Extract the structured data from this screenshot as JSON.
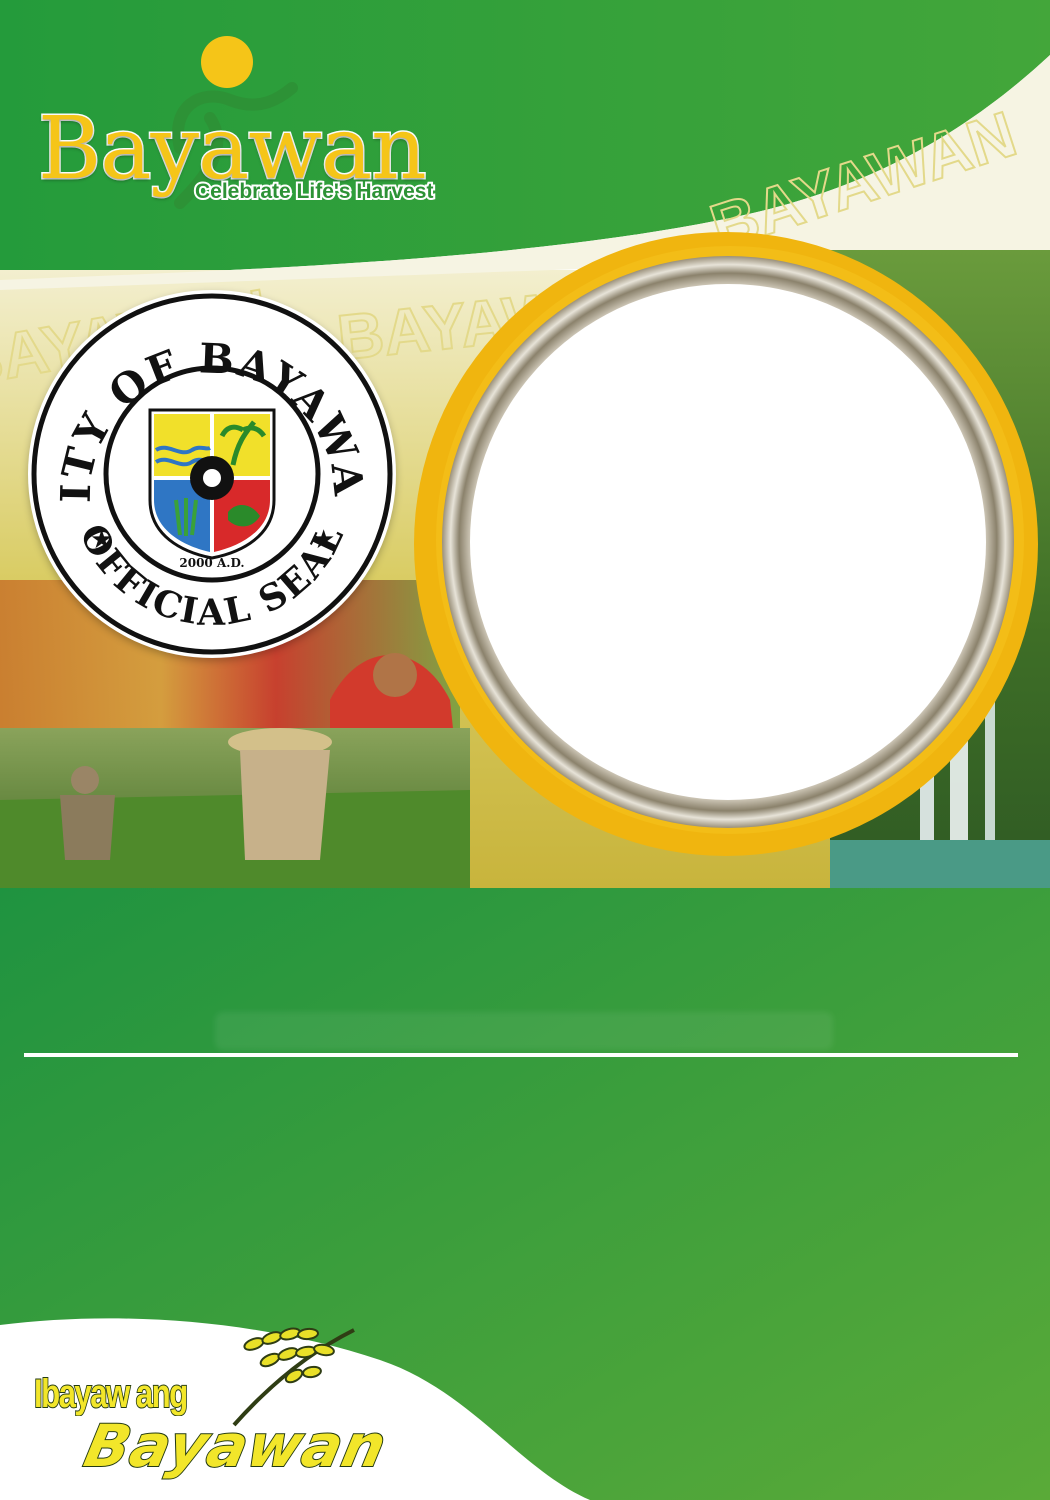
{
  "brand": {
    "wordmark": "Bayawan",
    "tagline": "Celebrate Life's Harvest",
    "logo_icon": "dancing-figure-icon"
  },
  "banner": {
    "watermark_text": "BAYAWAN"
  },
  "seal": {
    "top_text": "CITY OF BAYAWAN",
    "bottom_text": "OFFICIAL SEAL",
    "year": "2000 A.D.",
    "icon": "coat-of-arms-icon"
  },
  "photo_frame": {
    "icon": "gold-ring-frame-icon"
  },
  "slogan": {
    "line1": "Ibayaw ang",
    "line2": "Bayawan",
    "icon": "rice-stalk-icon"
  },
  "colors": {
    "primary_green": "#229a3b",
    "light_green": "#5dae3a",
    "accent_yellow": "#f5c518",
    "frame_gold": "#f0b50f",
    "white": "#ffffff"
  }
}
